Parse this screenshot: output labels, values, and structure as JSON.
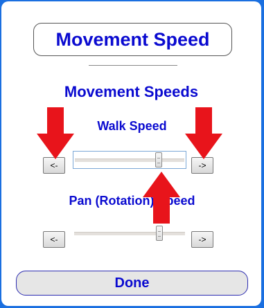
{
  "dialog": {
    "title": "Movement Speed",
    "section_heading": "Movement Speeds"
  },
  "walk_speed": {
    "label": "Walk Speed",
    "decrease_label": "<-",
    "increase_label": "->",
    "value_fraction": 0.79
  },
  "pan_speed": {
    "label": "Pan (Rotation) Speed",
    "decrease_label": "<-",
    "increase_label": "->",
    "value_fraction": 0.79
  },
  "done_label": "Done",
  "annotation_color": "#e8141b",
  "accent_color": "#0a0ad0",
  "frame_color": "#1a6fe0"
}
